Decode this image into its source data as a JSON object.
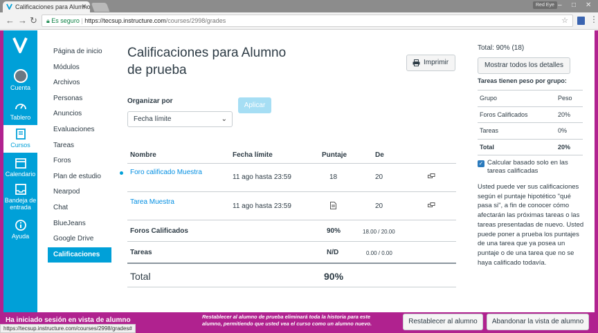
{
  "browser": {
    "tab_title": "Calificaciones para Alumno",
    "profile": "Red Eye",
    "secure_label": "Es seguro",
    "url_host": "https://tecsup.instructure.com",
    "url_path": "/courses/2998/grades",
    "status_url": "https://tecsup.instructure.com/courses/2998/grades#"
  },
  "global_nav": {
    "items": [
      {
        "label": "Cuenta"
      },
      {
        "label": "Tablero"
      },
      {
        "label": "Cursos"
      },
      {
        "label": "Calendario"
      },
      {
        "label": "Bandeja de entrada"
      },
      {
        "label": "Ayuda"
      }
    ]
  },
  "course_nav": {
    "items": [
      "Página de inicio",
      "Módulos",
      "Archivos",
      "Personas",
      "Anuncios",
      "Evaluaciones",
      "Tareas",
      "Foros",
      "Plan de estudio",
      "Nearpod",
      "Chat",
      "BlueJeans",
      "Google Drive",
      "Calificaciones"
    ],
    "active_index": 13
  },
  "main": {
    "title_line1": "Calificaciones para Alumno",
    "title_line2": "de prueba",
    "print_label": "Imprimir",
    "sort_label": "Organizar por",
    "sort_value": "Fecha límite",
    "apply_label": "Aplicar",
    "table": {
      "headers": [
        "Nombre",
        "Fecha límite",
        "Puntaje",
        "De"
      ],
      "rows": [
        {
          "name": "Foro calificado Muestra",
          "due": "11 ago hasta 23:59",
          "score": "18",
          "out_of": "20"
        },
        {
          "name": "Tarea Muestra",
          "due": "11 ago hasta 23:59",
          "score": "",
          "out_of": "20"
        }
      ],
      "groups": [
        {
          "name": "Foros Calificados",
          "percent": "90%",
          "points": "18.00 / 20.00"
        },
        {
          "name": "Tareas",
          "percent": "N/D",
          "points": "0.00 / 0.00"
        }
      ],
      "total_label": "Total",
      "total_value": "90%"
    }
  },
  "sidebar": {
    "total_line": "Total: 90% (18)",
    "details_button": "Mostrar todos los detalles",
    "weighted_heading": "Tareas tienen peso por grupo:",
    "weights_header": {
      "group": "Grupo",
      "weight": "Peso"
    },
    "weights": [
      {
        "group": "Foros Calificados",
        "weight": "20%"
      },
      {
        "group": "Tareas",
        "weight": "0%"
      },
      {
        "group": "Total",
        "weight": "20%"
      }
    ],
    "checkbox_label": "Calcular basado solo en las tareas calificadas",
    "info_text": "Usted puede ver sus calificaciones según el puntaje hipotético \"qué pasa si\", a fin de conocer cómo afectarán las próximas tareas o las tareas presentadas de nuevo. Usted puede poner a prueba los puntajes de una tarea que ya posea un puntaje o de una tarea que no se haya calificado todavía."
  },
  "footer": {
    "title": "Ha iniciado sesión en vista de alumno",
    "message": "Restablecer al alumno de prueba eliminará toda la historia para este alumno, permitiendo que usted vea el curso como un alumno nuevo.",
    "reset_button": "Restablecer al alumno",
    "leave_button": "Abandonar la vista de alumno"
  }
}
